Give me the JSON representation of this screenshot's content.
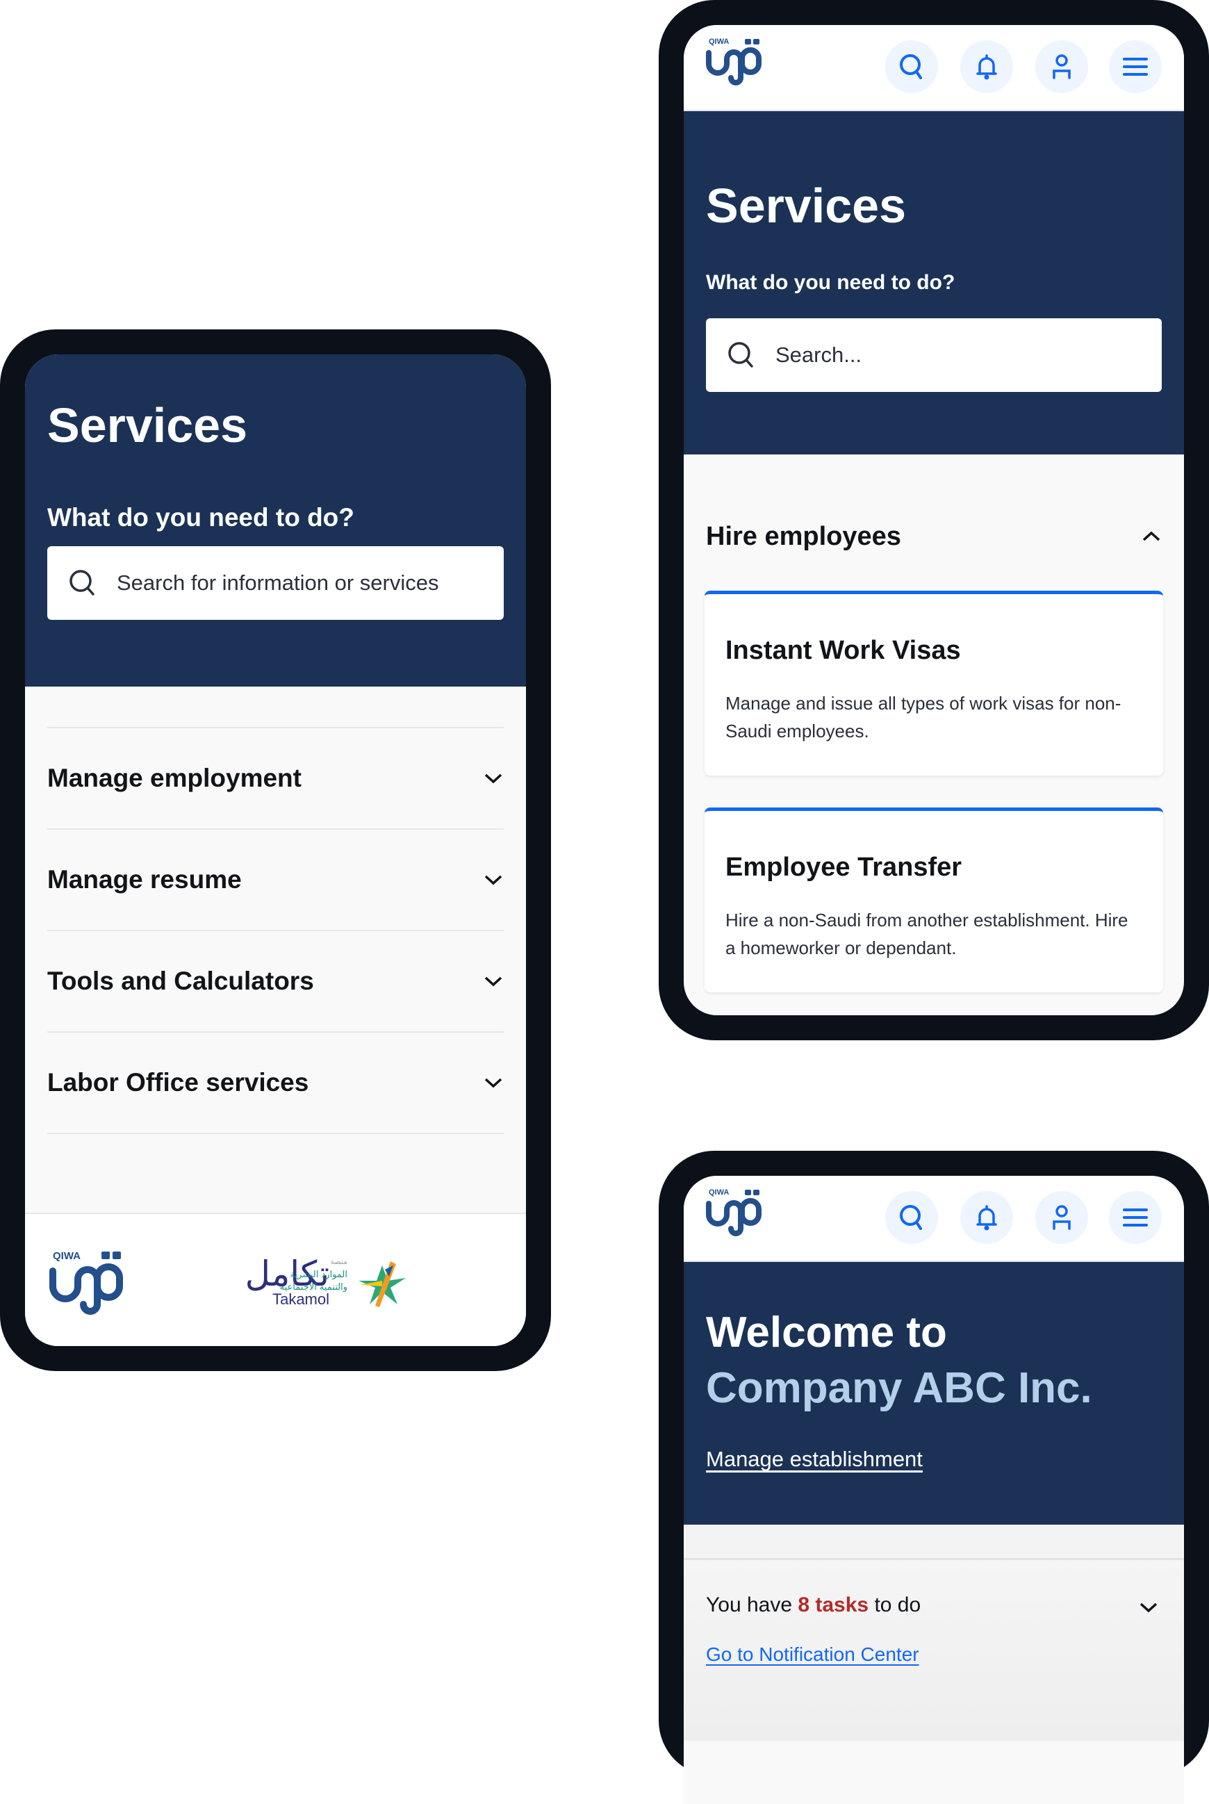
{
  "colors": {
    "hero_bg": "#1b3256",
    "accent_blue": "#1167f5",
    "highlight_light_blue": "#b3cfea",
    "task_red": "#b52a2a",
    "phone_frame": "#0c1018"
  },
  "phone_left": {
    "title": "Services",
    "prompt": "What do you need to do?",
    "search": {
      "placeholder": "Search for information or services",
      "icon": "search-icon"
    },
    "sections": [
      {
        "label": "Manage employment",
        "icon": "chevron-down-icon"
      },
      {
        "label": "Manage resume",
        "icon": "chevron-down-icon"
      },
      {
        "label": "Tools and Calculators",
        "icon": "chevron-down-icon"
      },
      {
        "label": "Labor Office services",
        "icon": "chevron-down-icon"
      }
    ],
    "footer": {
      "qiwa_label": "QIWA",
      "takamol_arabic": "تكامل",
      "takamol_label": "Takamol",
      "hrsd_top": "منصة",
      "hrsd_line1": "الموارد البشرية",
      "hrsd_line2": "والتنمية الاجتماعية"
    }
  },
  "phone_top_right": {
    "logo_label": "QIWA",
    "header_icons": [
      "search-icon",
      "bell-icon",
      "user-icon",
      "menu-icon"
    ],
    "title": "Services",
    "prompt": "What do you need to do?",
    "search": {
      "placeholder": "Search...",
      "icon": "search-icon"
    },
    "section": {
      "label": "Hire employees",
      "icon": "chevron-up-icon",
      "expanded": true
    },
    "cards": [
      {
        "title": "Instant Work Visas",
        "description": "Manage and issue all types of work visas for non-Saudi employees."
      },
      {
        "title": "Employee Transfer",
        "description": "Hire a non-Saudi from another establishment. Hire a homeworker or dependant."
      }
    ]
  },
  "phone_bottom_right": {
    "logo_label": "QIWA",
    "header_icons": [
      "search-icon",
      "bell-icon",
      "user-icon",
      "menu-icon"
    ],
    "welcome_line1": "Welcome to",
    "company_name": "Company ABC Inc.",
    "manage_link": "Manage establishment",
    "tasks": {
      "prefix": "You have ",
      "count_text": "8 tasks",
      "suffix": " to do",
      "icon": "chevron-down-icon"
    },
    "notification_link": "Go to Notification Center"
  }
}
